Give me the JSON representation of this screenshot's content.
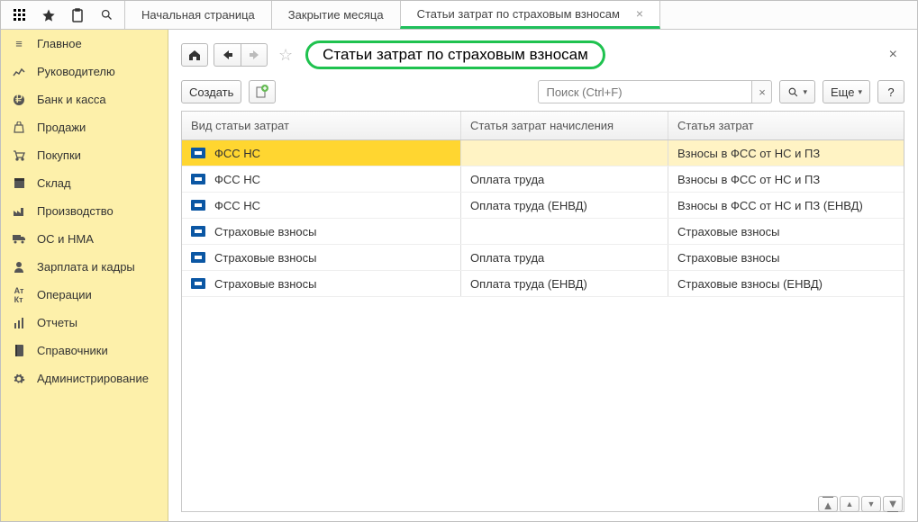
{
  "topbar": {
    "tabs": [
      {
        "label": "Начальная страница",
        "active": false,
        "closable": false
      },
      {
        "label": "Закрытие месяца",
        "active": false,
        "closable": true
      },
      {
        "label": "Статьи затрат по страховым взносам",
        "active": true,
        "closable": true
      }
    ]
  },
  "sidebar": {
    "items": [
      {
        "key": "main",
        "label": "Главное",
        "icon": "menu-icon"
      },
      {
        "key": "manager",
        "label": "Руководителю",
        "icon": "chart-icon"
      },
      {
        "key": "bank",
        "label": "Банк и касса",
        "icon": "ruble-icon"
      },
      {
        "key": "sales",
        "label": "Продажи",
        "icon": "bag-icon"
      },
      {
        "key": "purchase",
        "label": "Покупки",
        "icon": "cart-icon"
      },
      {
        "key": "warehouse",
        "label": "Склад",
        "icon": "box-icon"
      },
      {
        "key": "production",
        "label": "Производство",
        "icon": "factory-icon"
      },
      {
        "key": "assets",
        "label": "ОС и НМА",
        "icon": "truck-icon"
      },
      {
        "key": "hr",
        "label": "Зарплата и кадры",
        "icon": "person-icon"
      },
      {
        "key": "ops",
        "label": "Операции",
        "icon": "ops-icon"
      },
      {
        "key": "reports",
        "label": "Отчеты",
        "icon": "report-icon"
      },
      {
        "key": "refs",
        "label": "Справочники",
        "icon": "book-icon"
      },
      {
        "key": "admin",
        "label": "Администрирование",
        "icon": "gear-icon"
      }
    ]
  },
  "page": {
    "title": "Статьи затрат по страховым взносам",
    "create_label": "Создать",
    "search_placeholder": "Поиск (Ctrl+F)",
    "more_label": "Еще",
    "help_label": "?"
  },
  "grid": {
    "columns": [
      "Вид статьи затрат",
      "Статья затрат начисления",
      "Статья затрат"
    ],
    "rows": [
      {
        "type": "ФСС НС",
        "accrual": "",
        "expense": "Взносы в ФСС от НС и ПЗ",
        "selected": true
      },
      {
        "type": "ФСС НС",
        "accrual": "Оплата труда",
        "expense": "Взносы в ФСС от НС и ПЗ",
        "selected": false
      },
      {
        "type": "ФСС НС",
        "accrual": "Оплата труда (ЕНВД)",
        "expense": "Взносы в ФСС от НС и ПЗ (ЕНВД)",
        "selected": false
      },
      {
        "type": "Страховые взносы",
        "accrual": "",
        "expense": "Страховые взносы",
        "selected": false
      },
      {
        "type": "Страховые взносы",
        "accrual": "Оплата труда",
        "expense": "Страховые взносы",
        "selected": false
      },
      {
        "type": "Страховые взносы",
        "accrual": "Оплата труда (ЕНВД)",
        "expense": "Страховые взносы (ЕНВД)",
        "selected": false
      }
    ]
  }
}
